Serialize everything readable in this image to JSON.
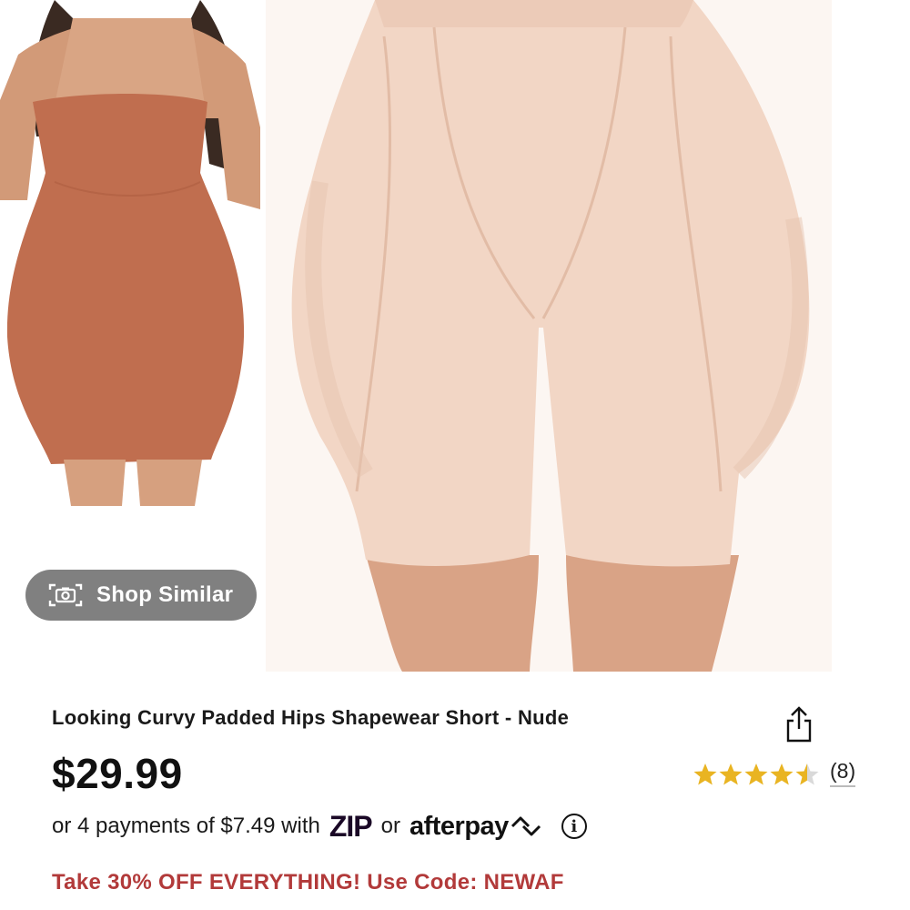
{
  "media": {
    "thumbnail_alt": "product thumbnail",
    "main_image_alt": "product main image",
    "shop_similar_label": "Shop Similar"
  },
  "product": {
    "title": "Looking Curvy Padded Hips Shapewear Short - Nude",
    "price": "$29.99",
    "rating": 4.5,
    "review_count": "(8)"
  },
  "payments": {
    "prefix": "or 4 payments of $7.49 with",
    "zip_logo": "ZIP",
    "or_label": "or",
    "afterpay_logo": "afterpay"
  },
  "promo": {
    "text": "Take 30% OFF EVERYTHING! Use Code: NEWAF"
  },
  "colors": {
    "star": "#e9b422",
    "promo": "#b23a3a",
    "pill_bg": "#6e6e6e"
  }
}
